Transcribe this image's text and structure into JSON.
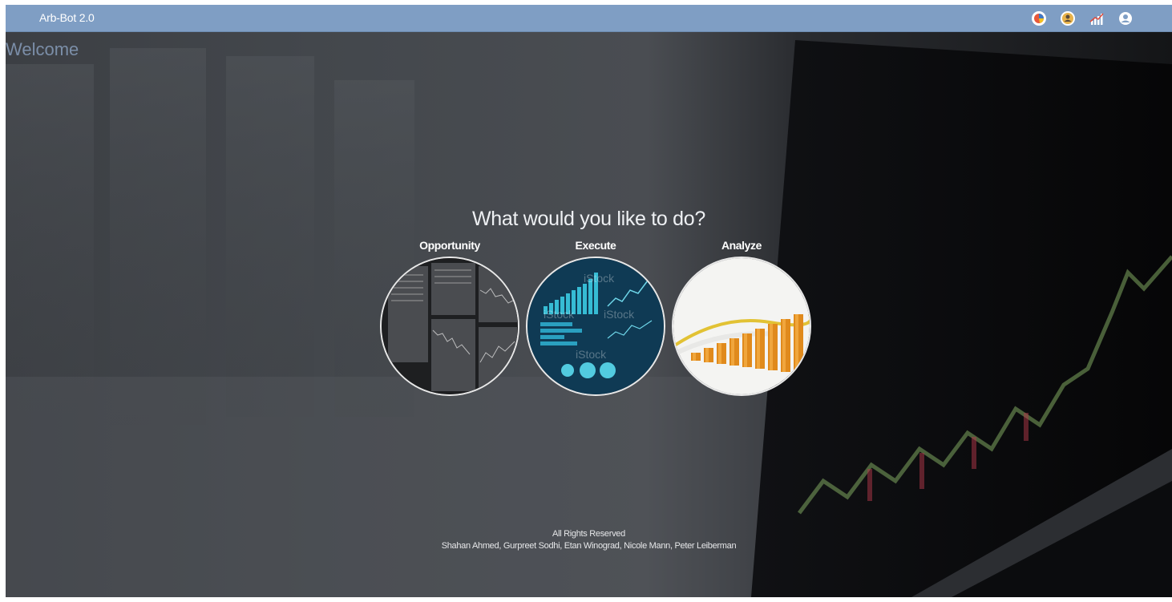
{
  "navbar": {
    "brand": "Arb-Bot 2.0",
    "icons": [
      "portfolio-icon",
      "user-icon",
      "stats-icon",
      "account-icon"
    ]
  },
  "hero": {
    "welcome": "Welcome",
    "prompt": "What would you like to do?",
    "choices": [
      {
        "label": "Opportunity",
        "image": "trading-screens-image"
      },
      {
        "label": "Execute",
        "image": "blue-charts-image"
      },
      {
        "label": "Analyze",
        "image": "gold-bars-image"
      }
    ]
  },
  "footer": {
    "rights": "All Rights Reserved",
    "authors": "Shahan Ahmed, Gurpreet Sodhi, Etan Winograd, Nicole Mann, Peter Leiberman"
  },
  "colors": {
    "navbar": "#7f9ec4",
    "welcome_text": "#7b8ea8",
    "background_dark": "#1b1d20"
  }
}
